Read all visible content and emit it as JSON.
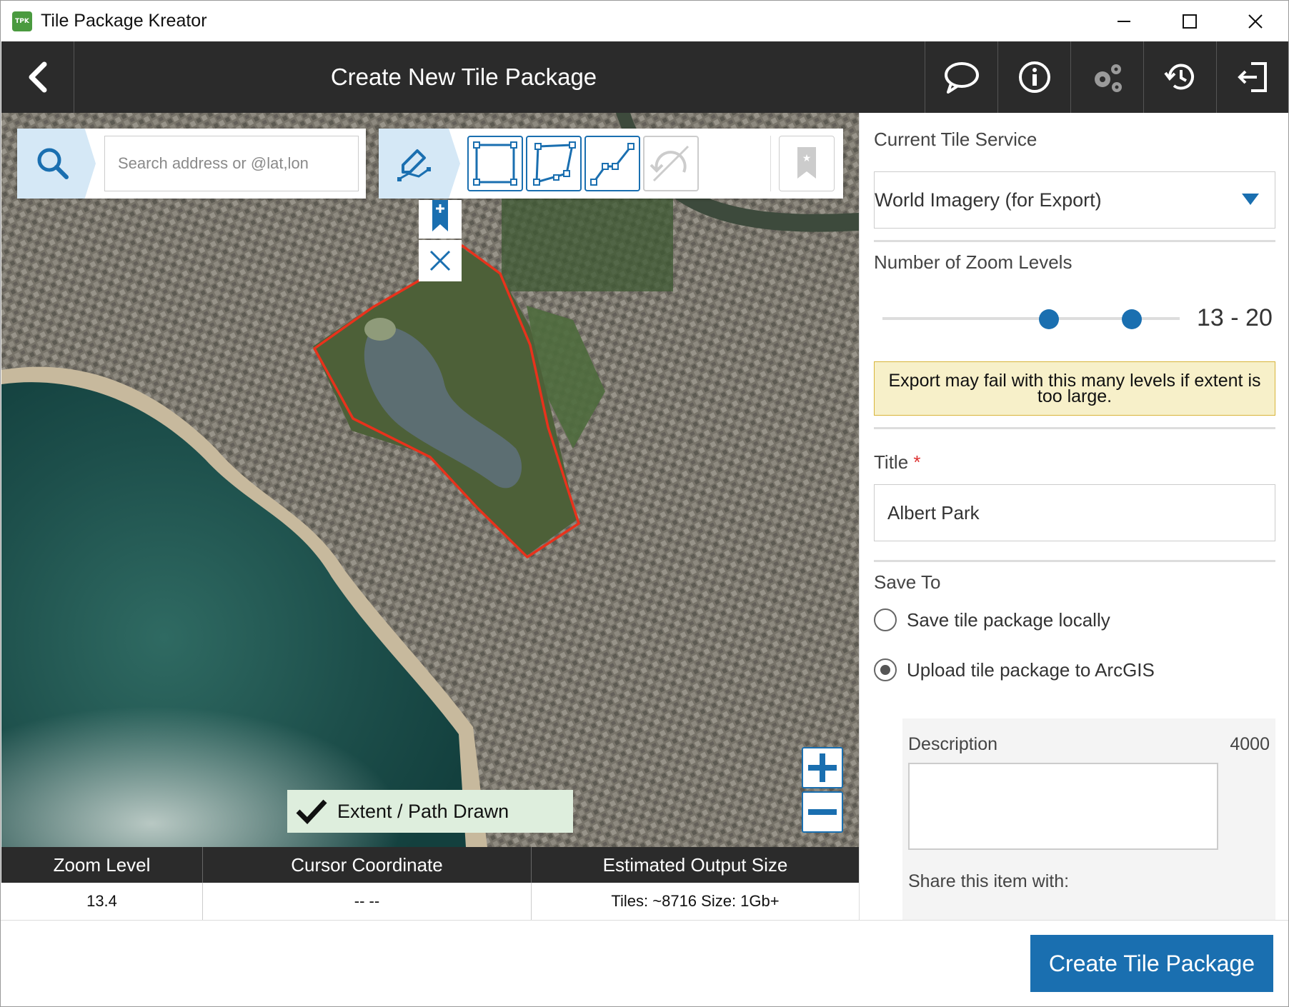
{
  "window": {
    "app_title": "Tile Package Kreator",
    "logo_text": "TPK",
    "controls": [
      "minimize-icon",
      "maximize-icon",
      "close-icon"
    ]
  },
  "header": {
    "title": "Create New Tile Package",
    "icons": [
      "speech-bubble-icon",
      "info-icon",
      "gears-icon",
      "history-icon",
      "sign-out-icon"
    ]
  },
  "map": {
    "search_placeholder": "Search address or @lat,lon",
    "tools": [
      "pencil-icon",
      "rectangle-tool-icon",
      "polygon-tool-icon",
      "polyline-tool-icon",
      "undo-redo-icon",
      "bookmark-icon"
    ],
    "extent_status": "Extent / Path Drawn",
    "accent_color": "#1a6fb0",
    "extent_outline_color": "#e8321c"
  },
  "info_table": {
    "headers": [
      "Zoom Level",
      "Cursor Coordinate",
      "Estimated Output Size"
    ],
    "values": [
      "13.4",
      "-- --",
      "Tiles: ~8716 Size: 1Gb+"
    ]
  },
  "panel": {
    "tile_service_label": "Current Tile Service",
    "tile_service_value": "World Imagery (for Export)",
    "zoom_levels_label": "Number of Zoom Levels",
    "zoom_range": "13 - 20",
    "zoom_min_fraction": 0.56,
    "zoom_max_fraction": 0.84,
    "warning": "Export may fail with this many levels if extent is too large.",
    "title_label": "Title",
    "required_mark": "*",
    "title_value": "Albert Park",
    "save_to_label": "Save To",
    "save_local_label": "Save tile package locally",
    "upload_label": "Upload tile package to ArcGIS",
    "selected_option": "upload",
    "description_label": "Description",
    "description_count": "4000",
    "share_label": "Share this item with:"
  },
  "footer": {
    "create_button": "Create Tile Package"
  }
}
